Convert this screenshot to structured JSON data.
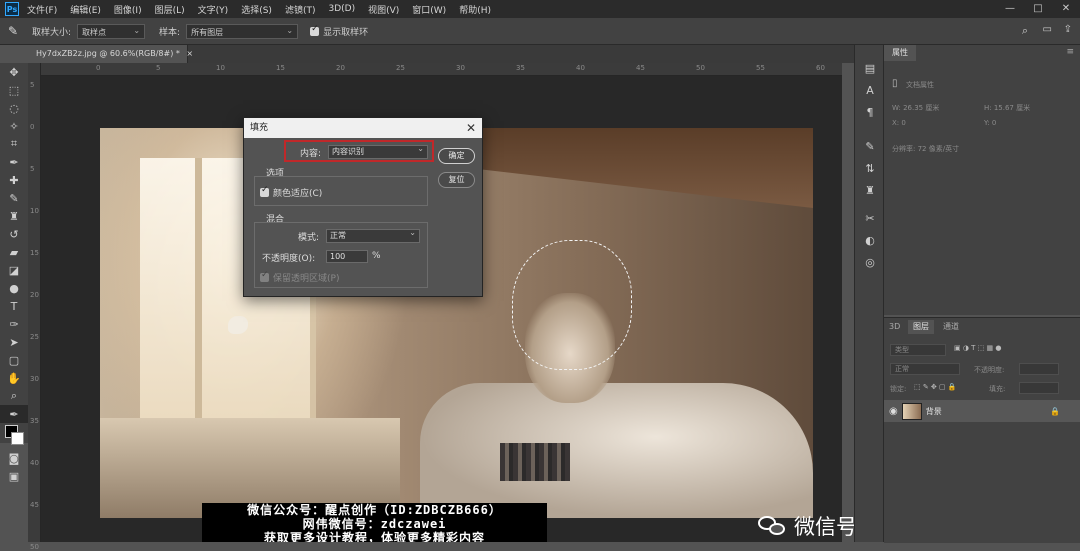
{
  "menubar": {
    "logo": "Ps",
    "items": [
      "文件(F)",
      "编辑(E)",
      "图像(I)",
      "图层(L)",
      "文字(Y)",
      "选择(S)",
      "滤镜(T)",
      "3D(D)",
      "视图(V)",
      "窗口(W)",
      "帮助(H)"
    ],
    "window_controls": [
      "—",
      "□",
      "✕"
    ]
  },
  "options_bar": {
    "sample_size_label": "取样大小:",
    "sample_size_value": "取样点",
    "sample_label": "样本:",
    "sample_value": "所有图层",
    "show_ring_label": "显示取样环"
  },
  "document_tab": {
    "title": "Hy7dxZB2z.jpg @ 60.6%(RGB/8#) *",
    "close": "×"
  },
  "ruler": {
    "top_ticks": [
      "0",
      "5",
      "10",
      "15",
      "20",
      "25",
      "30",
      "35",
      "40",
      "45",
      "50",
      "55",
      "60"
    ],
    "left_ticks": [
      "5",
      "0",
      "5",
      "10",
      "15",
      "20",
      "25",
      "30",
      "35",
      "40",
      "45",
      "50"
    ]
  },
  "fill_dialog": {
    "title": "填充",
    "close": "✕",
    "content_label": "内容:",
    "content_value": "内容识别",
    "ok_label": "确定",
    "reset_label": "复位",
    "options_label": "选项",
    "color_adapt_label": "颜色适应(C)",
    "blend_label": "混合",
    "mode_label": "模式:",
    "mode_value": "正常",
    "opacity_label": "不透明度(O):",
    "opacity_value": "100",
    "opacity_unit": "%",
    "preserve_label": "保留透明区域(P)"
  },
  "properties_panel": {
    "tab": "属性",
    "doc_label": "文档属性",
    "w_label": "W: 26.35 厘米",
    "h_label": "H: 15.67 厘米",
    "x_label": "X: 0",
    "y_label": "Y: 0",
    "resolution_label": "分辨率: 72 像素/英寸"
  },
  "layers_panel": {
    "tabs": [
      "3D",
      "图层",
      "通道"
    ],
    "kind_filter": "类型",
    "blend_mode": "正常",
    "opacity_label": "不透明度:",
    "lock_label": "锁定:",
    "fill_label": "填充:",
    "layer_name": "背景"
  },
  "watermarks": {
    "line1": "微信公众号：醒点创作（ID:ZDBCZB666）",
    "line2": "网伟微信号：zdczawei",
    "line3": "获取更多设计教程，体验更多精彩内容",
    "wechat_id": "微信号: ZDBCZB666"
  },
  "colors": {
    "accent_red": "#c0282a",
    "ps_blue": "#31a8ff"
  }
}
